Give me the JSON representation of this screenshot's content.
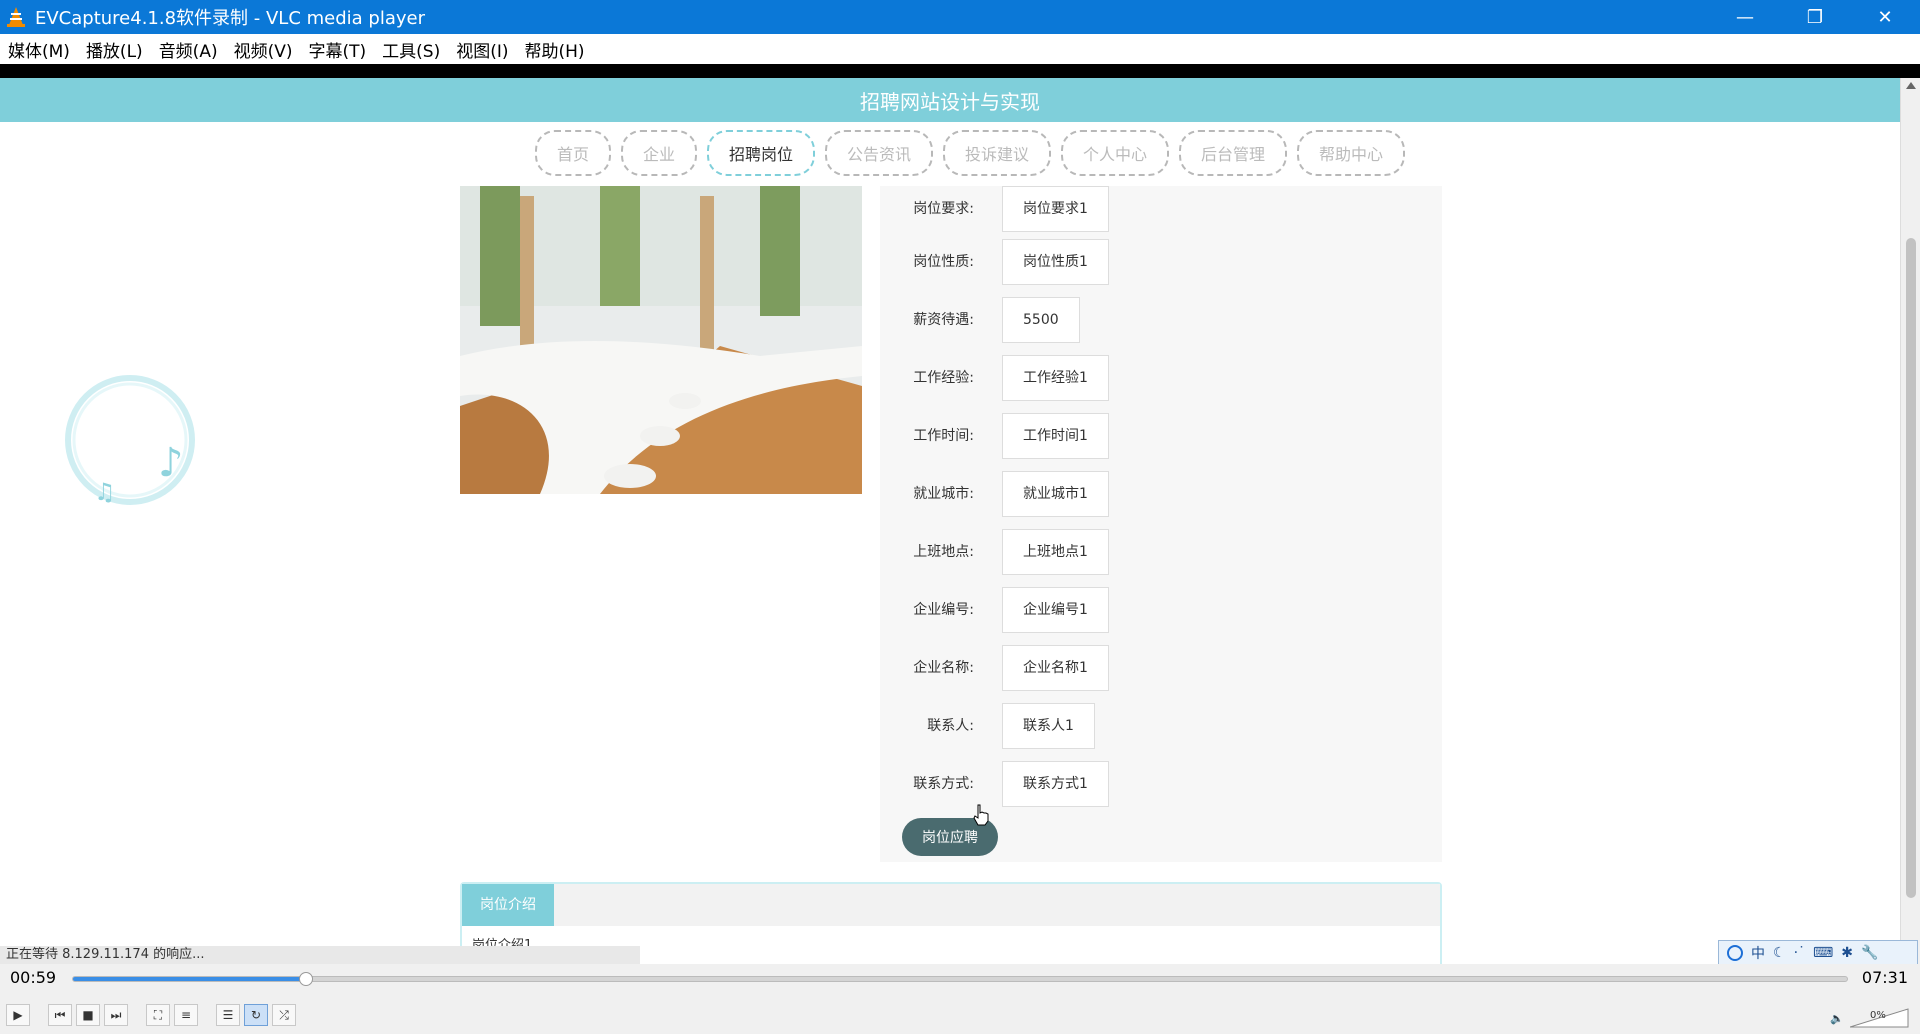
{
  "window": {
    "title": "EVCapture4.1.8软件录制 - VLC media player",
    "minimize_icon": "minimize-icon",
    "restore_icon": "restore-icon",
    "close_icon": "close-icon"
  },
  "menu": [
    "媒体(M)",
    "播放(L)",
    "音频(A)",
    "视频(V)",
    "字幕(T)",
    "工具(S)",
    "视图(I)",
    "帮助(H)"
  ],
  "site": {
    "title": "招聘网站设计与实现",
    "nav": [
      "首页",
      "企业",
      "招聘岗位",
      "公告资讯",
      "投诉建议",
      "个人中心",
      "后台管理",
      "帮助中心"
    ],
    "active_nav": "招聘岗位",
    "accent_color": "#7fcfda"
  },
  "job": {
    "fields": [
      {
        "label": "岗位要求:",
        "value": "岗位要求1"
      },
      {
        "label": "岗位性质:",
        "value": "岗位性质1"
      },
      {
        "label": "薪资待遇:",
        "value": "5500"
      },
      {
        "label": "工作经验:",
        "value": "工作经验1"
      },
      {
        "label": "工作时间:",
        "value": "工作时间1"
      },
      {
        "label": "就业城市:",
        "value": "就业城市1"
      },
      {
        "label": "上班地点:",
        "value": "上班地点1"
      },
      {
        "label": "企业编号:",
        "value": "企业编号1"
      },
      {
        "label": "企业名称:",
        "value": "企业名称1"
      },
      {
        "label": "联系人:",
        "value": "联系人1"
      },
      {
        "label": "联系方式:",
        "value": "联系方式1"
      }
    ],
    "apply_button": "岗位应聘",
    "intro_tab": "岗位介绍",
    "intro_text": "岗位介绍1"
  },
  "browser_status": "正在等待 8.129.11.174 的响应...",
  "ime": {
    "lang": "中"
  },
  "player": {
    "elapsed": "00:59",
    "total": "07:31",
    "progress": 0.131,
    "volume": "0%"
  }
}
